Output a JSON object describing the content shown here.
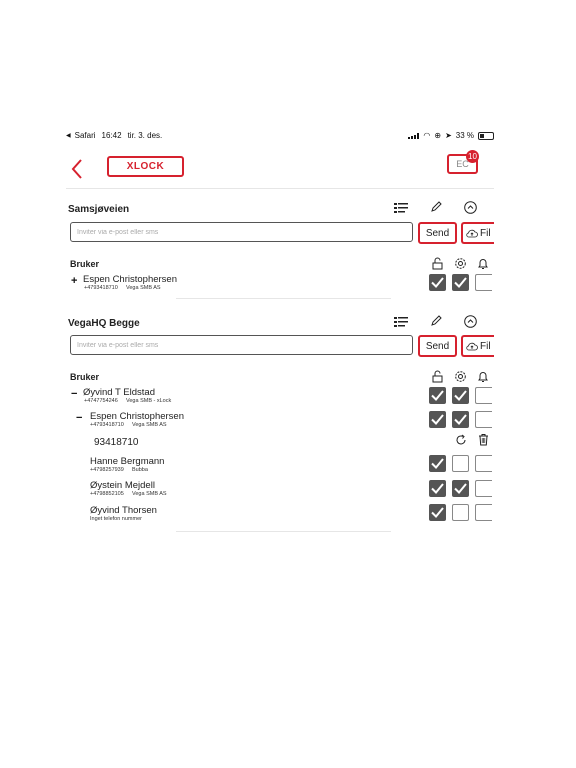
{
  "status_bar": {
    "browser": "Safari",
    "time": "16:42",
    "date": "tir. 3. des.",
    "battery": "33 %"
  },
  "header": {
    "logo_text": "XLOCK",
    "user_initials": "EC",
    "notification_count": "10"
  },
  "colors": {
    "accent": "#d6212e"
  },
  "common": {
    "invite_placeholder": "Inviter via e-post eller sms",
    "send_label": "Send",
    "file_label": "Fil",
    "users_header": "Bruker"
  },
  "groups": [
    {
      "name": "Samsjøveien",
      "users": [
        {
          "sign": "+",
          "name": "Espen Christophersen",
          "phone": "+4793418710",
          "org": "Vega SMB AS",
          "perms": [
            true,
            true,
            false
          ]
        }
      ]
    },
    {
      "name": "VegaHQ Begge",
      "users": [
        {
          "sign": "−",
          "name": "Øyvind T Eldstad",
          "phone": "+4747754246",
          "org": "Vega SMB - xLock",
          "perms": [
            true,
            true,
            false
          ]
        },
        {
          "sign": "−",
          "name": "Espen Christophersen",
          "phone": "+4793418710",
          "org": "Vega SMB AS",
          "perms": [
            true,
            true,
            false
          ],
          "edit_phone": "93418710"
        },
        {
          "name": "Hanne Bergmann",
          "phone": "+4798257939",
          "org": "Bubba",
          "perms": [
            true,
            false,
            false
          ]
        },
        {
          "name": "Øystein Mejdell",
          "phone": "+4798852105",
          "org": "Vega SMB AS",
          "perms": [
            true,
            true,
            false
          ]
        },
        {
          "name": "Øyvind Thorsen",
          "phone": "Inget telefon nummer",
          "org": "",
          "perms": [
            true,
            false,
            false
          ]
        }
      ]
    }
  ]
}
